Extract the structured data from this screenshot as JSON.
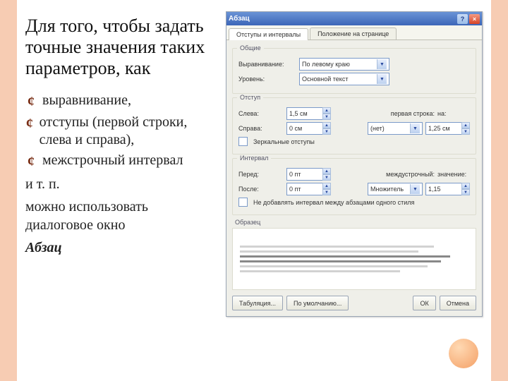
{
  "side": {
    "heading": "Для того, чтобы задать точные значения таких параметров, как",
    "bullets": [
      "выравнивание,",
      "отступы (первой строки, слева и справа),",
      "межстрочный интервал"
    ],
    "etc": "и т. п.",
    "foot1": "можно использовать диалоговое окно",
    "foot2": "Абзац"
  },
  "dlg": {
    "title": "Абзац",
    "help": "?",
    "close": "×",
    "tabs": {
      "a": "Отступы и интервалы",
      "b": "Положение на странице"
    },
    "g1": {
      "title": "Общие",
      "align_l": "Выравнивание:",
      "align_v": "По левому краю",
      "level_l": "Уровень:",
      "level_v": "Основной текст"
    },
    "g2": {
      "title": "Отступ",
      "left_l": "Слева:",
      "left_v": "1,5 см",
      "right_l": "Справа:",
      "right_v": "0 см",
      "first_l": "первая строка:",
      "first_sel": "(нет)",
      "by_l": "на:",
      "by_v": "1,25 см",
      "mirror": "Зеркальные отступы"
    },
    "g3": {
      "title": "Интервал",
      "before_l": "Перед:",
      "before_v": "0 пт",
      "after_l": "После:",
      "after_v": "0 пт",
      "line_l": "междустрочный:",
      "line_sel": "Множитель",
      "line_by_l": "значение:",
      "line_by_v": "1,15",
      "nos": "Не добавлять интервал между абзацами одного стиля"
    },
    "prev": "Образец",
    "btn_tab": "Табуляция...",
    "btn_def": "По умолчанию...",
    "btn_ok": "ОК",
    "btn_cancel": "Отмена"
  }
}
